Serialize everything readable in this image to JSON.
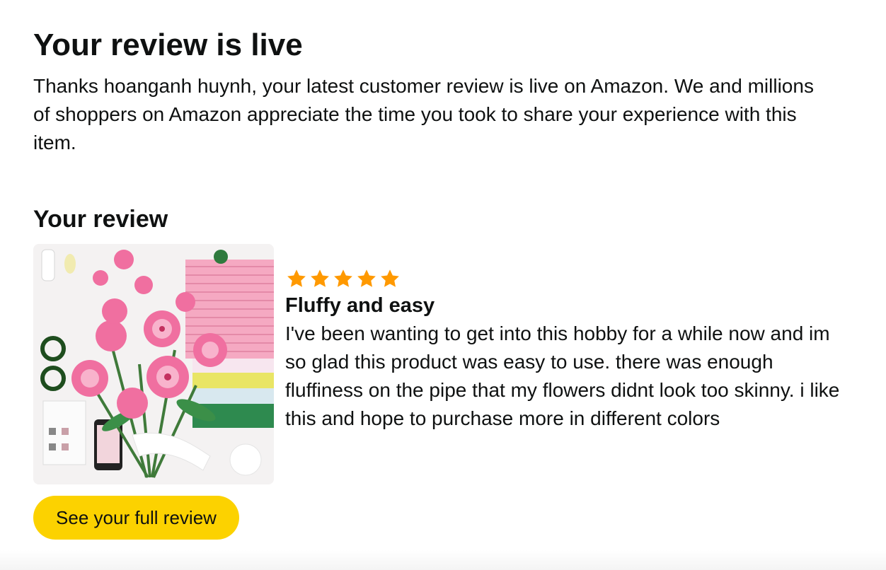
{
  "email": {
    "headline": "Your review is live",
    "intro": "Thanks hoanganh huynh, your latest customer review is live on Amazon. We and millions of shoppers on Amazon appreciate the time you took to share your experience with this item."
  },
  "review_section": {
    "title": "Your review",
    "product_image_icon": "flower-bouquet-product-image",
    "rating": 5,
    "rating_max": 5,
    "star_color": "#ff9900",
    "review_title": "Fluffy and easy",
    "review_text": "I've been wanting to get into this hobby for a while now and im so glad this product was easy to use. there was enough fluffiness on the pipe that my flowers didnt look too skinny. i like this and hope to purchase more in different colors"
  },
  "cta": {
    "label": "See your full review",
    "color": "#fcd200"
  }
}
